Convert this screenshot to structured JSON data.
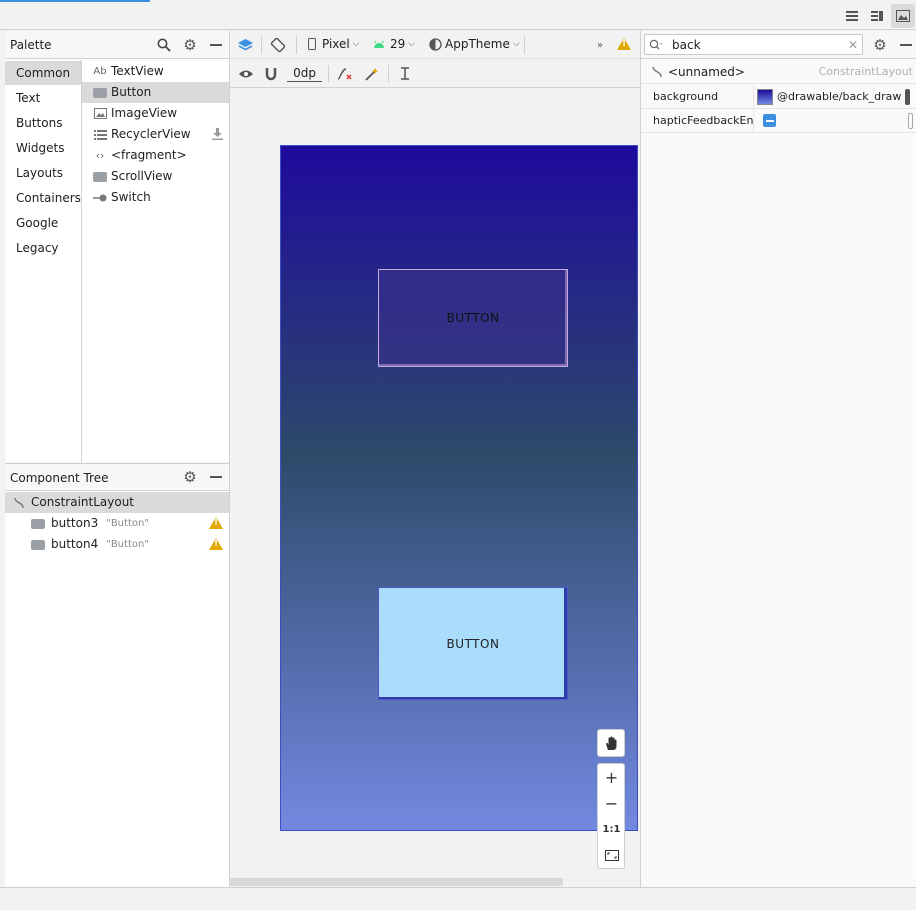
{
  "toolbar_top": {
    "view_icons": [
      "code-view-icon",
      "split-view-icon",
      "design-view-icon"
    ]
  },
  "palette": {
    "title": "Palette",
    "categories": [
      "Common",
      "Text",
      "Buttons",
      "Widgets",
      "Layouts",
      "Containers",
      "Google",
      "Legacy"
    ],
    "selected_category": "Common",
    "widgets": [
      {
        "icon": "Ab",
        "label": "TextView"
      },
      {
        "icon": "button-icon",
        "label": "Button"
      },
      {
        "icon": "image-icon",
        "label": "ImageView"
      },
      {
        "icon": "list-icon",
        "label": "RecyclerView"
      },
      {
        "icon": "code-icon",
        "label": "<fragment>"
      },
      {
        "icon": "scroll-icon",
        "label": "ScrollView"
      },
      {
        "icon": "switch-icon",
        "label": "Switch"
      }
    ],
    "selected_widget": "Button"
  },
  "design_toolbar": {
    "device": "Pixel",
    "api": "29",
    "theme": "AppTheme",
    "margin": "0dp"
  },
  "component_tree": {
    "title": "Component Tree",
    "root": "ConstraintLayout",
    "children": [
      {
        "id": "button3",
        "text": "\"Button\""
      },
      {
        "id": "button4",
        "text": "\"Button\""
      }
    ]
  },
  "attributes": {
    "search_value": "back",
    "component_name": "<unnamed>",
    "component_type": "ConstraintLayout",
    "rows": [
      {
        "name": "background",
        "value": "@drawable/back_draw"
      },
      {
        "name": "hapticFeedbackEn...",
        "value": ""
      }
    ]
  },
  "canvas": {
    "button_top_label": "BUTTON",
    "button_bottom_label": "BUTTON",
    "gradient_colors": [
      "#1e0a9c",
      "#2d4a6a",
      "#7289e0"
    ],
    "zoom_reset_label": "1:1"
  },
  "colors": {
    "accent_blue": "#3d8fe0",
    "warning": "#e0a800",
    "button_bottom_fill": "#aadcfc"
  }
}
